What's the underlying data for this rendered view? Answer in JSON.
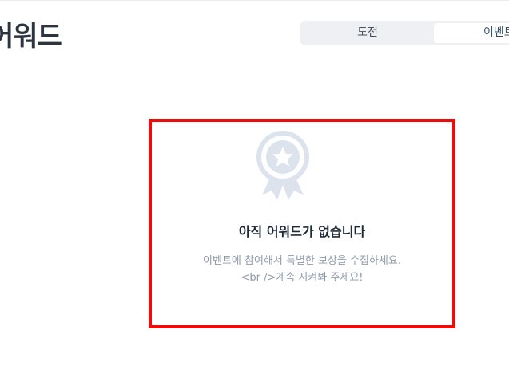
{
  "page": {
    "title": "어워드"
  },
  "tabs": [
    {
      "label": "도전",
      "selected": false
    },
    {
      "label": "이벤트",
      "selected": true
    }
  ],
  "empty_state": {
    "icon": "medal-ribbon-icon",
    "title": "아직 어워드가 없습니다",
    "description_line1": "이벤트에 참여해서 특별한 보상을 수집하세요.",
    "description_line2": "<br />계속 지켜봐 주세요!"
  },
  "colors": {
    "highlight_border": "#ee0b0b",
    "title_text": "#2c3440",
    "muted_text": "#8f9aaa",
    "icon_fill": "#dde3ec",
    "tab_background": "#eef0f3"
  }
}
